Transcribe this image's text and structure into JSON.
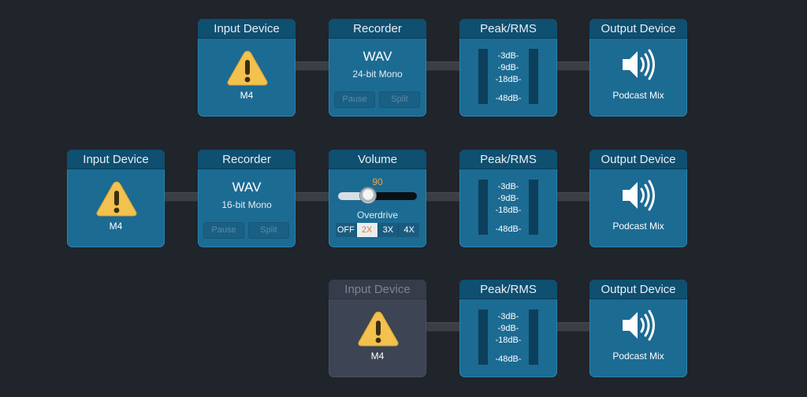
{
  "colors": {
    "background": "#20242b",
    "block": "#1c6b93",
    "header": "#0f4f70",
    "disabled_block": "#3d4453",
    "warning": "#f2c14e",
    "accent": "#f4a23c"
  },
  "rows": [
    {
      "input": {
        "title": "Input Device",
        "device": "M4",
        "icon": "warning-icon"
      },
      "recorder": {
        "title": "Recorder",
        "format": "WAV",
        "detail": "24-bit Mono",
        "pause": "Pause",
        "split": "Split"
      },
      "meter": {
        "title": "Peak/RMS",
        "ticks": [
          "-3dB-",
          "-9dB-",
          "-18dB-",
          "-48dB-"
        ]
      },
      "output": {
        "title": "Output Device",
        "device": "Podcast Mix",
        "icon": "speaker-icon"
      }
    },
    {
      "input": {
        "title": "Input Device",
        "device": "M4",
        "icon": "warning-icon"
      },
      "recorder": {
        "title": "Recorder",
        "format": "WAV",
        "detail": "16-bit Mono",
        "pause": "Pause",
        "split": "Split"
      },
      "volume": {
        "title": "Volume",
        "value": "90",
        "level": 0.38,
        "overdrive_label": "Overdrive",
        "options": [
          "OFF",
          "2X",
          "3X",
          "4X"
        ],
        "selected": "2X"
      },
      "meter": {
        "title": "Peak/RMS",
        "ticks": [
          "-3dB-",
          "-9dB-",
          "-18dB-",
          "-48dB-"
        ]
      },
      "output": {
        "title": "Output Device",
        "device": "Podcast Mix",
        "icon": "speaker-icon"
      }
    },
    {
      "input": {
        "title": "Input Device",
        "device": "M4",
        "icon": "warning-icon",
        "state": "disabled"
      },
      "meter": {
        "title": "Peak/RMS",
        "ticks": [
          "-3dB-",
          "-9dB-",
          "-18dB-",
          "-48dB-"
        ]
      },
      "output": {
        "title": "Output Device",
        "device": "Podcast Mix",
        "icon": "speaker-icon"
      }
    }
  ]
}
